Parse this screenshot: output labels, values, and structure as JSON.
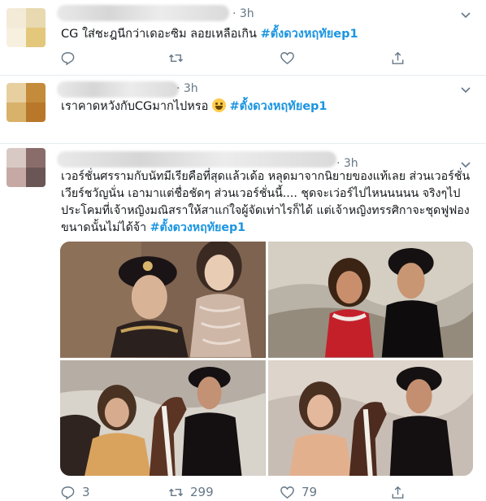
{
  "tweets": [
    {
      "time": "· 3h",
      "text_plain": "CG ใส่ชะฎนีกว่าเดอะซิม ลอยเหลือเกิน ",
      "hashtag": "#ตั้งดวงหฤทัยep1",
      "avatar_colors": [
        "#f3ead7",
        "#e8d9b0",
        "#f7f0df",
        "#e3c77a"
      ],
      "counts": {
        "reply": "",
        "retweet": "",
        "like": ""
      }
    },
    {
      "time": "· 3h",
      "text_plain": "เราคาดหวังกับCGมากไปหรอ ",
      "hashtag": "#ตั้งดวงหฤทัยep1",
      "avatar_colors": [
        "#e8cfa0",
        "#c48b3a",
        "#d8b16a",
        "#b9772a"
      ],
      "counts": {
        "reply": "",
        "retweet": "",
        "like": ""
      }
    },
    {
      "time": "· 3h",
      "lines": [
        "เวอร์ชั่นศรรามกับนัทมีเรียคือที่สุดแล้วเด้อ หลุดมาจากนิยายของแท้เลย ส่วนเวอร์ชั่น",
        "เวียร์ชวัญนั่น เอามาแต่ชื่อชัดๆ ส่วนเวอร์ชั่นนี้.... ชุดจะเว่อร์ไปไหนนนนน จริงๆไป",
        "ประโคมที่เจ้าหญิงมณิสราให้สาแก่ใจผู้จัดเท่าไรก็ได้ แต่เจ้าหญิงทรรศิกาจะชุดฟูฟอง",
        "ขนาดนั้นไม่ได้จ้า "
      ],
      "hashtag": "#ตั้งดวงหฤทัยep1",
      "avatar_colors": [
        "#d9c9c4",
        "#8a6d6a",
        "#c6a9a4",
        "#6b5656"
      ],
      "counts": {
        "reply": "3",
        "retweet": "299",
        "like": "79"
      }
    }
  ],
  "photos": [
    {
      "name": "photo-prince-and-lady",
      "bg": "#8b6a4c"
    },
    {
      "name": "photo-couple-red-dress",
      "bg": "#a8a49a"
    },
    {
      "name": "photo-woman-with-horse",
      "bg": "#c9c3ba"
    },
    {
      "name": "photo-man-and-woman-horse",
      "bg": "#c2b6ae"
    }
  ],
  "icons": {
    "reply": "reply-icon",
    "retweet": "retweet-icon",
    "like": "like-icon",
    "share": "share-icon",
    "caret": "chevron-down-icon"
  },
  "colors": {
    "hashtag": "#1b95e0",
    "meta": "#657786",
    "divider": "#e6ecf0"
  }
}
